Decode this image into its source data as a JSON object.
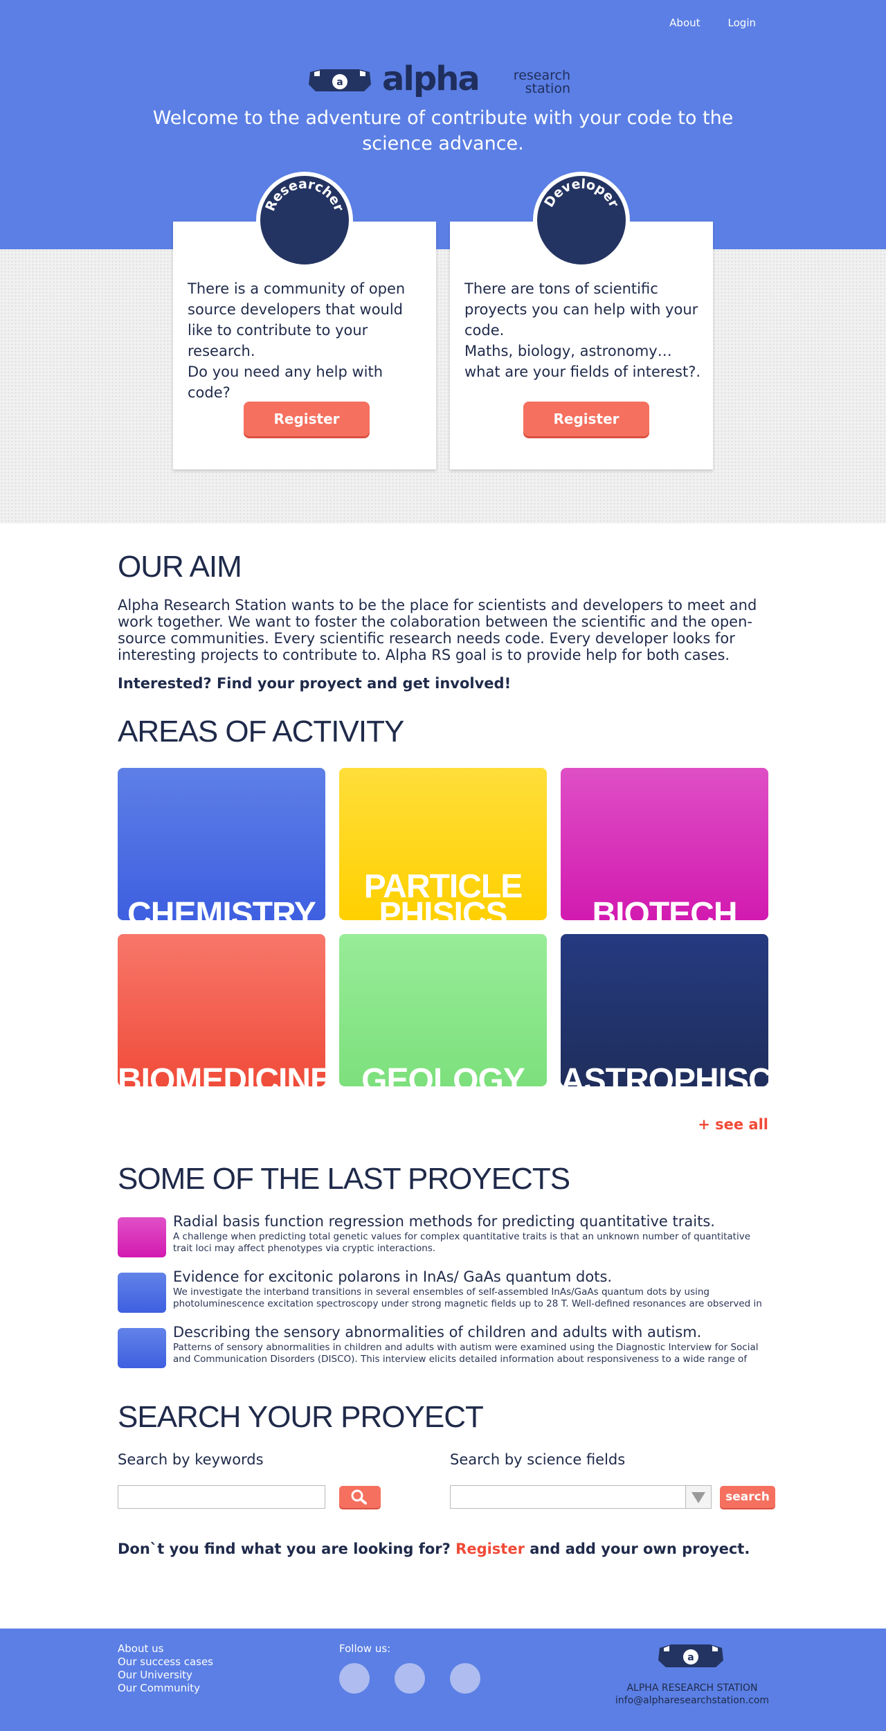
{
  "nav": {
    "about": "About",
    "login": "Login"
  },
  "brand": {
    "word": "alpha",
    "sub_line1": "research",
    "sub_line2": "station",
    "mark_letter": "a"
  },
  "hero": {
    "tagline": "Welcome to the adventure of contribute with your code to the science advance."
  },
  "cards": [
    {
      "badge": "Researcher",
      "text": "There is a community of open source developers that would like to contribute to your research.\nDo you need any help with code?",
      "button": "Register"
    },
    {
      "badge": "Developer",
      "text": "There are tons of scientific proyects you can help with your code.\nMaths, biology, astronomy… what are your fields of interest?.",
      "button": "Register"
    }
  ],
  "aim": {
    "title": "OUR AIM",
    "text": "Alpha Research Station wants to be the place for scientists and developers to meet and work together. We want to foster the colaboration between the scientific and the open-source communities. Every scientific research needs code. Every developer looks for interesting projects to contribute to. Alpha RS goal is to provide help for both cases.",
    "cta": "Interested? Find your proyect and get involved!"
  },
  "areas": {
    "title": "AREAS OF ACTIVITY",
    "tiles": [
      {
        "label": "CHEMISTRY",
        "color_top": "#5d7fe6",
        "color_bottom": "#3e5fe0"
      },
      {
        "label": "PARTICLE\nPHISICS",
        "color_top": "#ffde3a",
        "color_bottom": "#ffd000"
      },
      {
        "label": "BIOTECH",
        "color_top": "#de4fc5",
        "color_bottom": "#d21ab0"
      },
      {
        "label": "BIOMEDICINE",
        "color_top": "#f7776a",
        "color_bottom": "#f04c3a"
      },
      {
        "label": "GEOLOGY",
        "color_top": "#98ec98",
        "color_bottom": "#7ce07c"
      },
      {
        "label": "ASTROPHISCS",
        "color_top": "#253a80",
        "color_bottom": "#1f2e5c"
      }
    ],
    "see_all": "+ see all"
  },
  "projects": {
    "title": "SOME OF THE LAST PROYECTS",
    "items": [
      {
        "title": "Radial basis function regression methods for predicting quantitative traits.",
        "desc": "A challenge when predicting total genetic values for complex quantitative traits is that an unknown number of quantitative trait loci may affect phenotypes via cryptic interactions.",
        "color_top": "#e050c8",
        "color_bottom": "#d21ab0"
      },
      {
        "title": "Evidence for excitonic polarons in InAs/ GaAs quantum dots.",
        "desc": "We investigate the interband transitions in several ensembles of self-assembled InAs/GaAs quantum dots by using photoluminescence excitation spectroscopy under strong magnetic fields up to 28 T. Well-defined resonances are observed in the",
        "color_top": "#6283e8",
        "color_bottom": "#3e5fe0"
      },
      {
        "title": "Describing the sensory abnormalities of children and adults with autism.",
        "desc": "Patterns of sensory abnormalities in children and adults with autism were examined using the Diagnostic Interview for Social and Communication Disorders (DISCO). This interview elicits detailed information about responsiveness to a wide range of",
        "color_top": "#6283e8",
        "color_bottom": "#3e5fe0"
      }
    ]
  },
  "search": {
    "title": "SEARCH YOUR PROYECT",
    "keywords_label": "Search by keywords",
    "fields_label": "Search by science fields",
    "keywords_value": "",
    "button": "search",
    "cta_before": "Don`t you find what you are looking for?",
    "cta_link": "Register",
    "cta_after": "and add your own proyect."
  },
  "footer": {
    "links": [
      "About us",
      "Our success cases",
      "Our University",
      "Our Community"
    ],
    "follow": "Follow us:",
    "name": "ALPHA RESEARCH STATION",
    "email": "info@alpharesearchstation.com"
  }
}
